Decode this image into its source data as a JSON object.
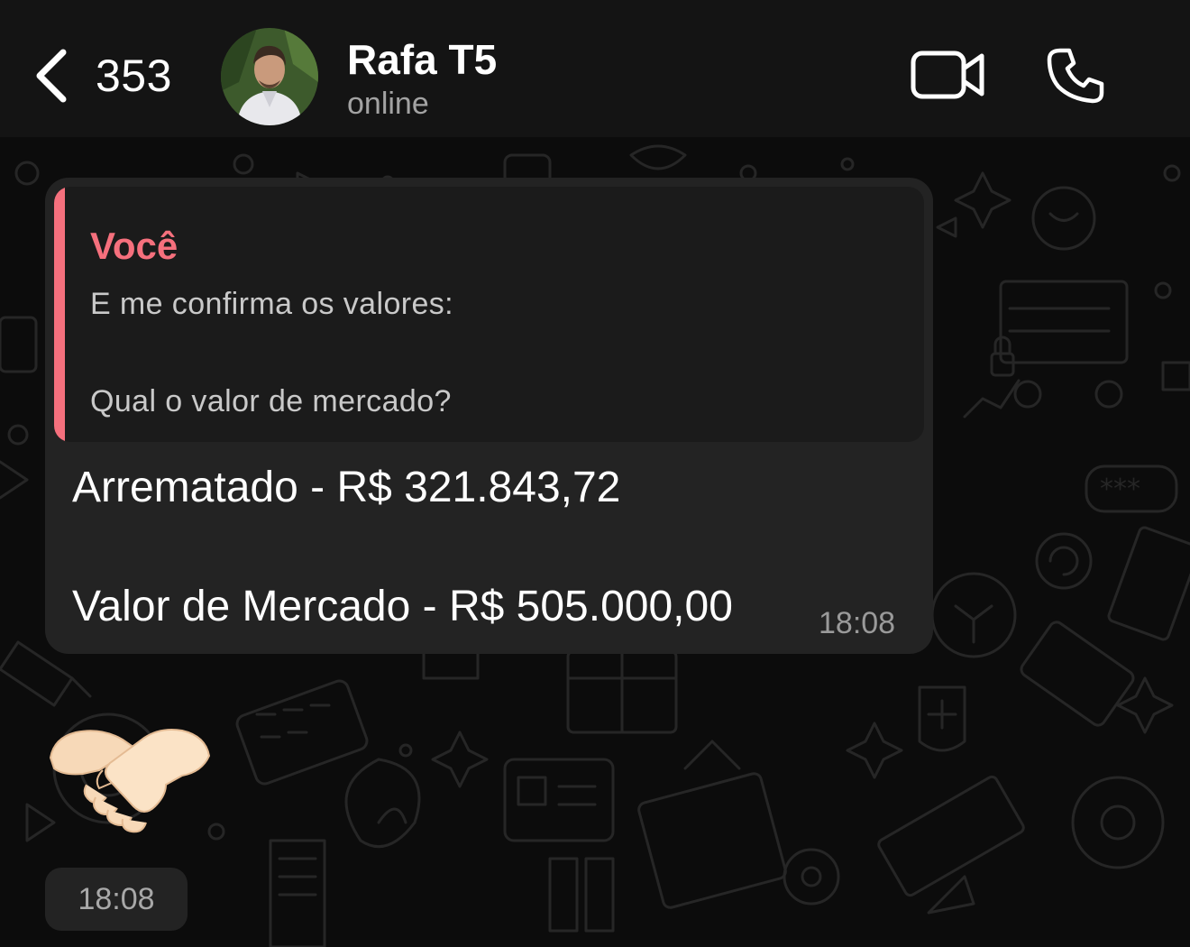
{
  "header": {
    "back_count": "353",
    "contact_name": "Rafa T5",
    "contact_status": "online",
    "icons": [
      "back-chevron-icon",
      "avatar",
      "video-camera-icon",
      "phone-icon"
    ]
  },
  "message": {
    "quote": {
      "author": "Você",
      "line1": "E me confirma os valores:",
      "line2": "Qual o valor de mercado?",
      "accent_color": "#f5707d"
    },
    "line1": "Arrematado - R$ 321.843,72",
    "line2": "Valor de Mercado - R$ 505.000,00",
    "time": "18:08"
  },
  "emoji_message": {
    "emoji": "handshake",
    "time": "18:08"
  }
}
